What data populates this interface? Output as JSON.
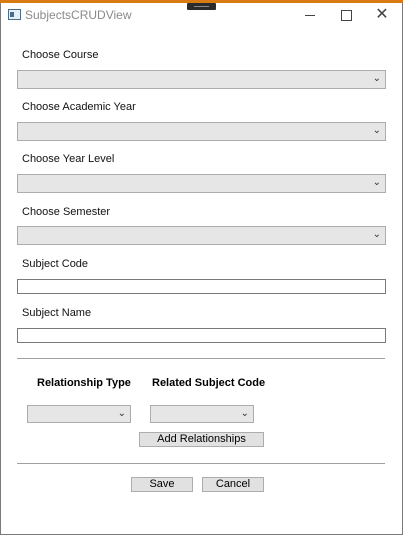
{
  "window": {
    "title": "SubjectsCRUDView"
  },
  "form": {
    "course_label": "Choose Course",
    "academic_year_label": "Choose Academic Year",
    "year_level_label": "Choose Year Level",
    "semester_label": "Choose Semester",
    "subject_code_label": "Subject Code",
    "subject_name_label": "Subject Name",
    "subject_code_value": "",
    "subject_name_value": ""
  },
  "relationships": {
    "type_header": "Relationship Type",
    "code_header": "Related Subject Code",
    "add_button": "Add Relationships"
  },
  "actions": {
    "save": "Save",
    "cancel": "Cancel"
  },
  "colors": {
    "accent": "#d97a12",
    "combo_bg": "#e6e6e6",
    "button_bg": "#e1e1e1"
  }
}
